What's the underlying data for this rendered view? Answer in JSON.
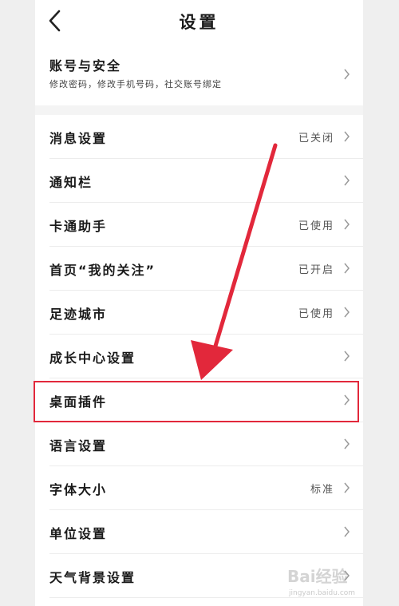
{
  "header": {
    "title": "设置"
  },
  "account": {
    "label": "账号与安全",
    "subtitle": "修改密码，修改手机号码，社交账号绑定"
  },
  "items": [
    {
      "label": "消息设置",
      "value": "已关闭"
    },
    {
      "label": "通知栏",
      "value": ""
    },
    {
      "label": "卡通助手",
      "value": "已使用"
    },
    {
      "label": "首页“我的关注”",
      "value": "已开启"
    },
    {
      "label": "足迹城市",
      "value": "已使用"
    },
    {
      "label": "成长中心设置",
      "value": ""
    },
    {
      "label": "桌面插件",
      "value": ""
    },
    {
      "label": "语言设置",
      "value": ""
    },
    {
      "label": "字体大小",
      "value": "标准"
    },
    {
      "label": "单位设置",
      "value": ""
    },
    {
      "label": "天气背景设置",
      "value": ""
    }
  ],
  "watermark": {
    "brand": "Bai经验",
    "url": "jingyan.baidu.com"
  },
  "colors": {
    "annotation": "#e2283b",
    "chevron": "#999999"
  }
}
